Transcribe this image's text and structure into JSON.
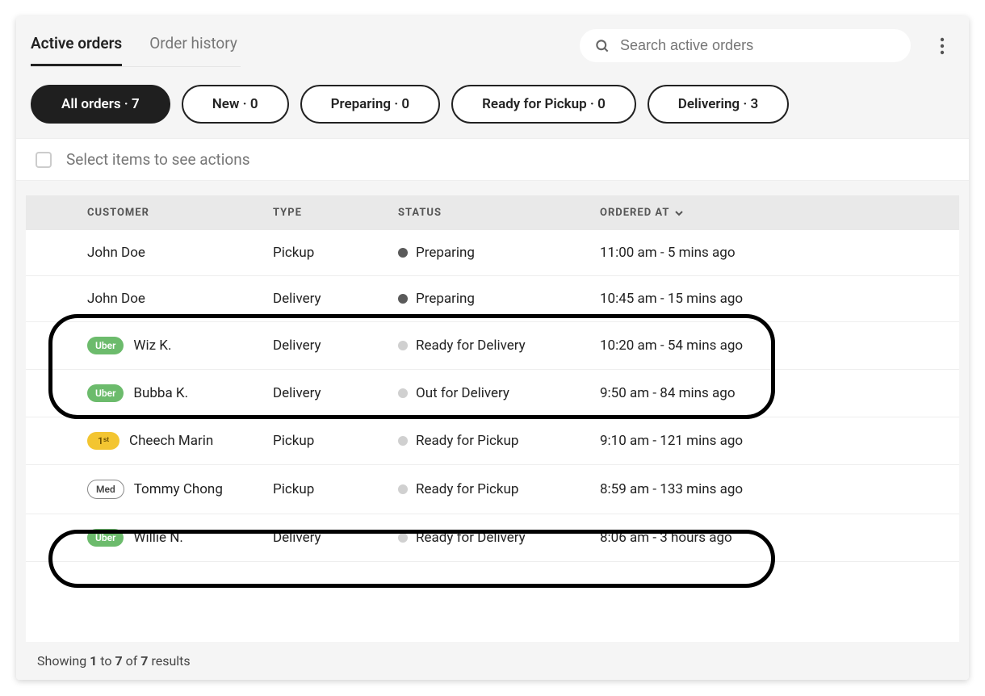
{
  "tabs": {
    "active": "Active orders",
    "history": "Order history"
  },
  "search": {
    "placeholder": "Search active orders"
  },
  "filters": [
    {
      "label": "All orders · 7",
      "active": true
    },
    {
      "label": "New · 0",
      "active": false
    },
    {
      "label": "Preparing · 0",
      "active": false
    },
    {
      "label": "Ready for Pickup · 0",
      "active": false
    },
    {
      "label": "Delivering · 3",
      "active": false
    }
  ],
  "selectionHint": "Select items to see actions",
  "columns": {
    "customer": "CUSTOMER",
    "type": "TYPE",
    "status": "STATUS",
    "orderedAt": "ORDERED AT"
  },
  "rows": [
    {
      "badge": null,
      "customer": "John Doe",
      "type": "Pickup",
      "statusDot": "dark",
      "status": "Preparing",
      "orderedAt": "11:00 am - 5 mins ago"
    },
    {
      "badge": null,
      "customer": "John Doe",
      "type": "Delivery",
      "statusDot": "dark",
      "status": "Preparing",
      "orderedAt": "10:45 am - 15 mins ago"
    },
    {
      "badge": "uber",
      "badgeText": "Uber",
      "customer": "Wiz K.",
      "type": "Delivery",
      "statusDot": "light",
      "status": "Ready for Delivery",
      "orderedAt": "10:20 am - 54 mins ago"
    },
    {
      "badge": "uber",
      "badgeText": "Uber",
      "customer": "Bubba K.",
      "type": "Delivery",
      "statusDot": "light",
      "status": "Out for Delivery",
      "orderedAt": "9:50 am - 84 mins ago"
    },
    {
      "badge": "first",
      "badgeText": "1ˢᵗ",
      "customer": "Cheech Marin",
      "type": "Pickup",
      "statusDot": "light",
      "status": "Ready for Pickup",
      "orderedAt": "9:10 am - 121 mins ago"
    },
    {
      "badge": "med",
      "badgeText": "Med",
      "customer": "Tommy Chong",
      "type": "Pickup",
      "statusDot": "light",
      "status": "Ready for Pickup",
      "orderedAt": "8:59 am - 133 mins ago"
    },
    {
      "badge": "uber",
      "badgeText": "Uber",
      "customer": "Willie N.",
      "type": "Delivery",
      "statusDot": "light",
      "status": "Ready for Delivery",
      "orderedAt": "8:06 am - 3 hours ago"
    }
  ],
  "footer": {
    "prefix": "Showing ",
    "from": "1",
    "mid1": " to ",
    "to": "7",
    "mid2": " of ",
    "total": "7",
    "suffix": " results"
  }
}
